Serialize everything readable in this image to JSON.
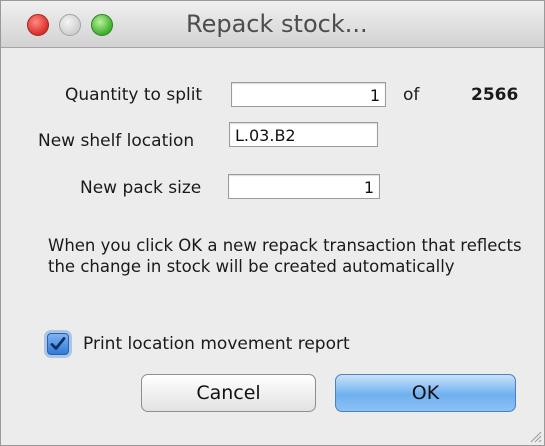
{
  "window": {
    "title": "Repack stock..."
  },
  "form": {
    "quantity_label": "Quantity to split",
    "quantity_value": "1",
    "of_label": "of",
    "total_quantity": "2566",
    "shelf_label": "New shelf location",
    "shelf_value": "L.03.B2",
    "pack_label": "New pack size",
    "pack_value": "1"
  },
  "info_text": "When you click OK a new repack transaction that reflects the change in stock will be created automatically",
  "options": {
    "print_report_label": "Print location movement report",
    "print_report_checked": true
  },
  "buttons": {
    "cancel_label": "Cancel",
    "ok_label": "OK"
  },
  "colors": {
    "accent": "#6fb0f0",
    "close": "#d9302a",
    "maximize": "#3fae2c"
  },
  "icons": [
    "close-light",
    "minimize-light",
    "maximize-light",
    "checkmark-icon",
    "resize-grip-icon"
  ]
}
